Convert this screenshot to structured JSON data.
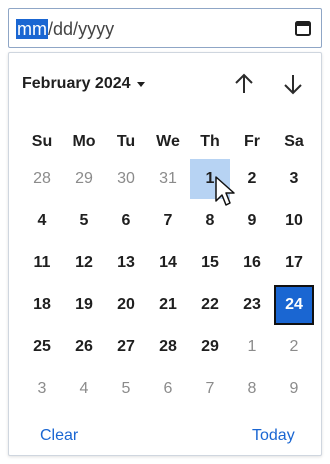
{
  "date_input": {
    "month_placeholder": "mm",
    "separator": "/",
    "day_placeholder": "dd",
    "year_placeholder": "yyyy"
  },
  "calendar": {
    "month_year_label": "February 2024",
    "weekdays": [
      "Su",
      "Mo",
      "Tu",
      "We",
      "Th",
      "Fr",
      "Sa"
    ],
    "weeks": [
      [
        {
          "label": "28",
          "type": "other"
        },
        {
          "label": "29",
          "type": "other"
        },
        {
          "label": "30",
          "type": "other"
        },
        {
          "label": "31",
          "type": "other"
        },
        {
          "label": "1",
          "type": "hover"
        },
        {
          "label": "2",
          "type": "current"
        },
        {
          "label": "3",
          "type": "current"
        }
      ],
      [
        {
          "label": "4",
          "type": "current"
        },
        {
          "label": "5",
          "type": "current"
        },
        {
          "label": "6",
          "type": "current"
        },
        {
          "label": "7",
          "type": "current"
        },
        {
          "label": "8",
          "type": "current"
        },
        {
          "label": "9",
          "type": "current"
        },
        {
          "label": "10",
          "type": "current"
        }
      ],
      [
        {
          "label": "11",
          "type": "current"
        },
        {
          "label": "12",
          "type": "current"
        },
        {
          "label": "13",
          "type": "current"
        },
        {
          "label": "14",
          "type": "current"
        },
        {
          "label": "15",
          "type": "current"
        },
        {
          "label": "16",
          "type": "current"
        },
        {
          "label": "17",
          "type": "current"
        }
      ],
      [
        {
          "label": "18",
          "type": "current"
        },
        {
          "label": "19",
          "type": "current"
        },
        {
          "label": "20",
          "type": "current"
        },
        {
          "label": "21",
          "type": "current"
        },
        {
          "label": "22",
          "type": "current"
        },
        {
          "label": "23",
          "type": "current"
        },
        {
          "label": "24",
          "type": "selected"
        }
      ],
      [
        {
          "label": "25",
          "type": "current"
        },
        {
          "label": "26",
          "type": "current"
        },
        {
          "label": "27",
          "type": "current"
        },
        {
          "label": "28",
          "type": "current"
        },
        {
          "label": "29",
          "type": "current"
        },
        {
          "label": "1",
          "type": "other"
        },
        {
          "label": "2",
          "type": "other"
        }
      ],
      [
        {
          "label": "3",
          "type": "other"
        },
        {
          "label": "4",
          "type": "other"
        },
        {
          "label": "5",
          "type": "other"
        },
        {
          "label": "6",
          "type": "other"
        },
        {
          "label": "7",
          "type": "other"
        },
        {
          "label": "8",
          "type": "other"
        },
        {
          "label": "9",
          "type": "other"
        }
      ]
    ],
    "footer": {
      "clear_label": "Clear",
      "today_label": "Today"
    }
  },
  "icons": {
    "calendar": "calendar-icon",
    "month_dropdown": "caret-down-icon",
    "previous_month": "arrow-up-icon",
    "next_month": "arrow-down-icon",
    "cursor": "mouse-pointer-icon"
  },
  "colors": {
    "accent": "#1a66d2",
    "hover": "#b7d3f3",
    "other_month_text": "#8b8b8b"
  }
}
